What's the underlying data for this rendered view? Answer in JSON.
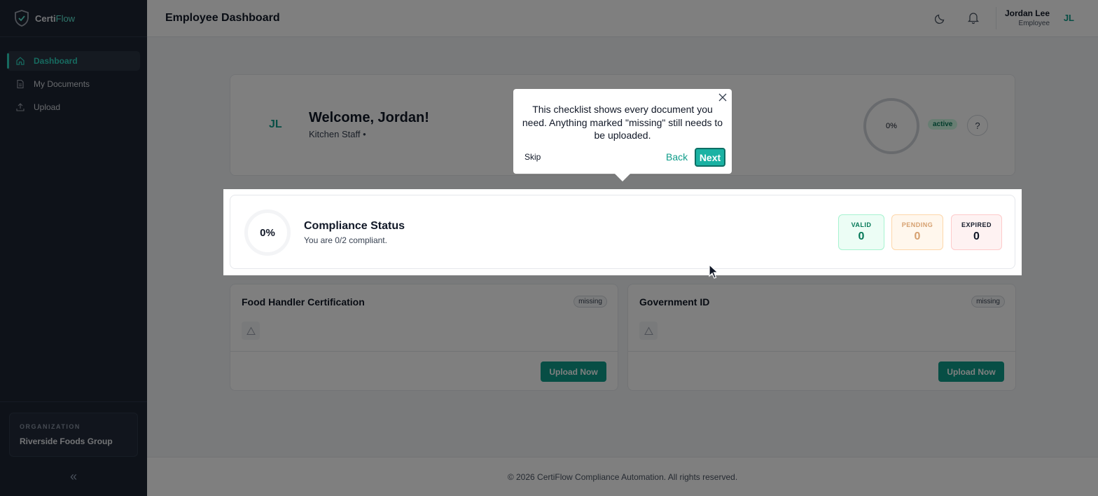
{
  "brand": {
    "name_part1": "Certi",
    "name_part2": "Flow"
  },
  "sidebar": {
    "items": [
      {
        "label": "Dashboard",
        "icon": "home-icon",
        "active": true
      },
      {
        "label": "My Documents",
        "icon": "document-icon",
        "active": false
      },
      {
        "label": "Upload",
        "icon": "upload-icon",
        "active": false
      }
    ],
    "org_label": "ORGANIZATION",
    "org_name": "Riverside Foods Group",
    "collapse_glyph": "«"
  },
  "header": {
    "title": "Employee Dashboard",
    "user_name": "Jordan Lee",
    "user_role": "Employee",
    "user_initials": "JL"
  },
  "welcome": {
    "initials": "JL",
    "title": "Welcome, Jordan!",
    "subtitle": "Kitchen Staff •",
    "progress_text": "0%",
    "status": "active",
    "help": "?"
  },
  "compliance": {
    "percent": "0%",
    "title": "Compliance Status",
    "subtitle": "You are 0/2 compliant.",
    "stats": [
      {
        "label": "VALID",
        "value": "0"
      },
      {
        "label": "PENDING",
        "value": "0"
      },
      {
        "label": "EXPIRED",
        "value": "0"
      }
    ]
  },
  "documents": [
    {
      "title": "Food Handler Certification",
      "status": "missing",
      "action": "Upload Now"
    },
    {
      "title": "Government ID",
      "status": "missing",
      "action": "Upload Now"
    }
  ],
  "tour": {
    "text": "This checklist shows every document you need. Anything marked \"missing\" still needs to be uploaded.",
    "skip": "Skip",
    "back": "Back",
    "next": "Next"
  },
  "footer": {
    "text": "© 2026 CertiFlow Compliance Automation. All rights reserved."
  },
  "colors": {
    "accent": "#0f9d8a",
    "sidebar_bg": "#1c2433",
    "active_teal": "#2dd4bf"
  }
}
